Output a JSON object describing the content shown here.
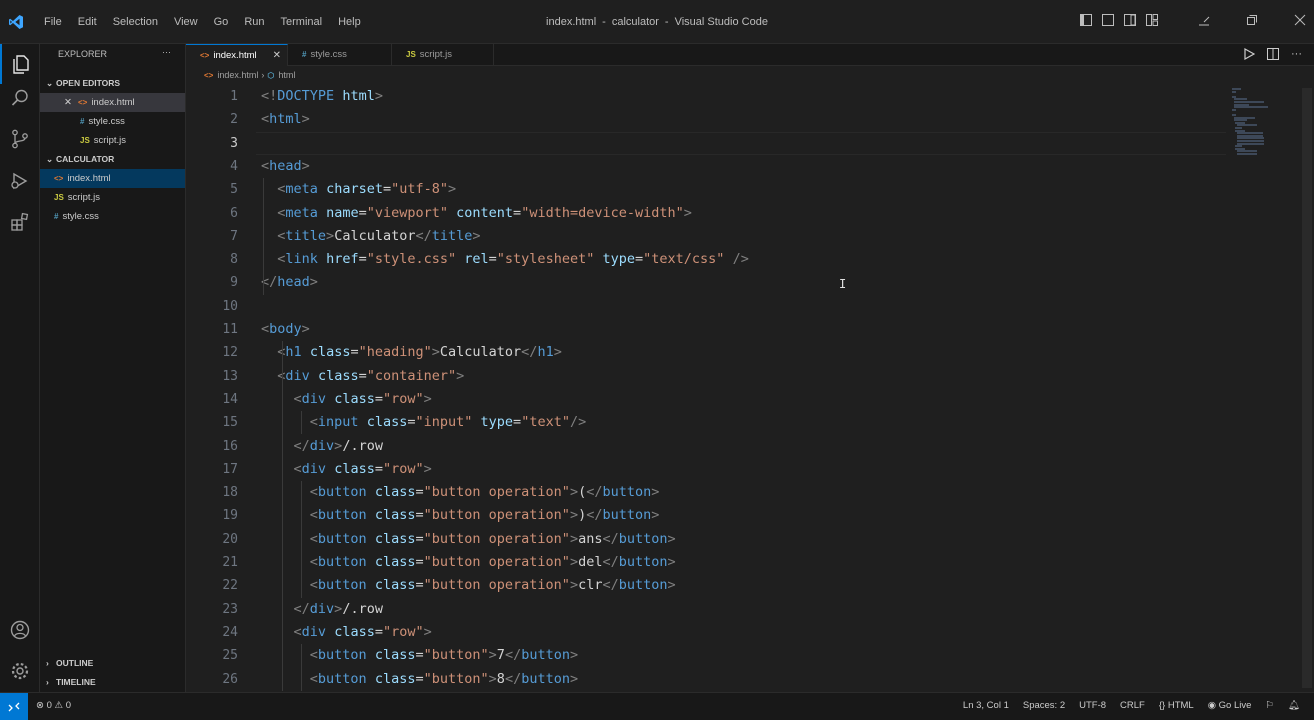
{
  "menu": [
    "File",
    "Edit",
    "Selection",
    "View",
    "Go",
    "Run",
    "Terminal",
    "Help"
  ],
  "window_title": {
    "file": "index.html",
    "folder": "calculator",
    "app": "Visual Studio Code"
  },
  "sidebar": {
    "title": "EXPLORER",
    "open_editors_label": "OPEN EDITORS",
    "open_editors": [
      {
        "name": "index.html",
        "icon": "html-file-icon"
      },
      {
        "name": "style.css",
        "icon": "css-file-icon"
      },
      {
        "name": "script.js",
        "icon": "js-file-icon"
      }
    ],
    "folder_label": "CALCULATOR",
    "files": [
      {
        "name": "index.html",
        "icon": "html-file-icon"
      },
      {
        "name": "script.js",
        "icon": "js-file-icon"
      },
      {
        "name": "style.css",
        "icon": "css-file-icon"
      }
    ],
    "outline_label": "OUTLINE",
    "timeline_label": "TIMELINE"
  },
  "tabs": [
    {
      "label": "index.html",
      "icon": "html-file-icon",
      "active": true
    },
    {
      "label": "style.css",
      "icon": "css-file-icon",
      "active": false
    },
    {
      "label": "script.js",
      "icon": "js-file-icon",
      "active": false
    }
  ],
  "breadcrumb": {
    "file": "index.html",
    "node": "html"
  },
  "editor": {
    "current_line": 3,
    "lines": [
      "<!DOCTYPE html>",
      "<html>",
      "",
      "<head>",
      "  <meta charset=\"utf-8\">",
      "  <meta name=\"viewport\" content=\"width=device-width\">",
      "  <title>Calculator</title>",
      "  <link href=\"style.css\" rel=\"stylesheet\" type=\"text/css\" />",
      "</head>",
      "",
      "<body>",
      "  <h1 class=\"heading\">Calculator</h1>",
      "  <div class=\"container\">",
      "    <div class=\"row\">",
      "      <input class=\"input\" type=\"text\"/>",
      "    </div>/.row",
      "    <div class=\"row\">",
      "      <button class=\"button operation\">(</button>",
      "      <button class=\"button operation\">)</button>",
      "      <button class=\"button operation\">ans</button>",
      "      <button class=\"button operation\">del</button>",
      "      <button class=\"button operation\">clr</button>",
      "    </div>/.row",
      "    <div class=\"row\">",
      "      <button class=\"button\">7</button>",
      "      <button class=\"button\">8</button>"
    ]
  },
  "status": {
    "problems": "0",
    "warnings": "0",
    "position": "Ln 3, Col 1",
    "spaces": "Spaces: 2",
    "encoding": "UTF-8",
    "eol": "CRLF",
    "language": "HTML",
    "golive": "Go Live"
  },
  "colors": {
    "accent": "#0078d4",
    "background": "#1f1f1f",
    "sidebar": "#181818"
  }
}
